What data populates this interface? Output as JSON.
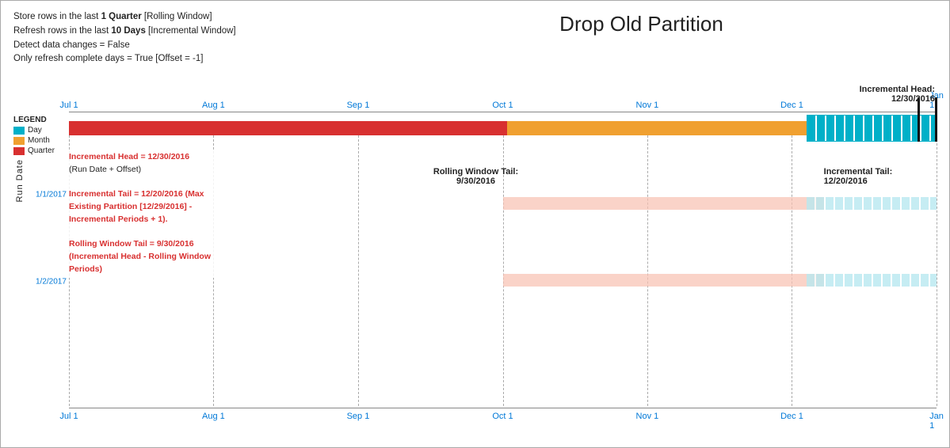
{
  "title": "Drop Old Partition",
  "info": {
    "line1_prefix": "Store rows in the last ",
    "line1_bold": "1 Quarter",
    "line1_suffix": " [Rolling Window]",
    "line2_prefix": "Refresh rows in the last ",
    "line2_bold": "10 Days",
    "line2_suffix": " [Incremental Window]",
    "line3": "Detect data changes = False",
    "line4": "Only refresh complete days = True [Offset = -1]"
  },
  "legend": {
    "title": "LEGEND",
    "items": [
      {
        "label": "Day",
        "color": "#00b0c8"
      },
      {
        "label": "Month",
        "color": "#f0a030"
      },
      {
        "label": "Quarter",
        "color": "#d83030"
      }
    ]
  },
  "axis": {
    "labels": [
      "Jul 1",
      "Aug 1",
      "Sep 1",
      "Oct 1",
      "Nov 1",
      "Dec 1",
      "Jan 1"
    ],
    "positions_pct": [
      0,
      16.66,
      33.33,
      50,
      66.66,
      83.33,
      100
    ]
  },
  "annotations": {
    "incremental_head_label": "Incremental Head:",
    "incremental_head_date": "12/30/2016",
    "rolling_window_tail_label": "Rolling Window Tail:",
    "rolling_window_tail_date": "9/30/2016",
    "incremental_tail_label": "Incremental Tail:",
    "incremental_tail_date": "12/20/2016"
  },
  "run_date_label": "Run Date",
  "row_dates": [
    "1/1/2017",
    "1/2/2017"
  ],
  "desc": {
    "head": "Incremental Head = 12/30/2016\n(Run Date + Offset)",
    "tail": "Incremental Tail = 12/20/2016 (Max\nExisting Partition [12/29/2016] -\nIncremental Periods + 1).",
    "rolling": "Rolling Window Tail = 9/30/2016\n(Incremental Head - Rolling Window\nPeriods)"
  },
  "colors": {
    "day": "#00b0c8",
    "month": "#f0a030",
    "quarter": "#d83030",
    "day_light": "#b0e8f0",
    "month_light": "#f8ddb0",
    "quarter_light": "#f0b0b0",
    "bracket": "#111111"
  }
}
